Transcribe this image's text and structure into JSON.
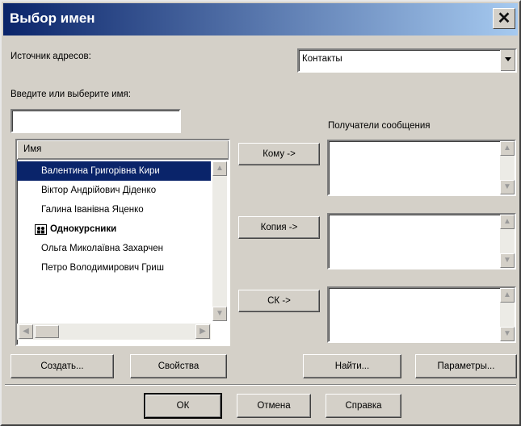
{
  "window": {
    "title": "Выбор имен"
  },
  "address_source": {
    "label": "Источник адресов:",
    "value": "Контакты"
  },
  "name_input": {
    "label": "Введите или выберите имя:",
    "value": ""
  },
  "names_list": {
    "header": "Имя",
    "items": [
      {
        "label": "Валентина Григорівна Кири",
        "selected": true,
        "group": false
      },
      {
        "label": "Віктор Андрійович Діденко",
        "selected": false,
        "group": false
      },
      {
        "label": "Галина Іванівна Яценко",
        "selected": false,
        "group": false
      },
      {
        "label": "Однокурсники",
        "selected": false,
        "group": true
      },
      {
        "label": "Ольга Миколаївна Захарчен",
        "selected": false,
        "group": false
      },
      {
        "label": "Петро Володимирович Гриш",
        "selected": false,
        "group": false
      }
    ]
  },
  "recipients": {
    "label": "Получатели сообщения",
    "to_button": "Кому ->",
    "cc_button": "Копия ->",
    "bcc_button": "СК ->"
  },
  "buttons": {
    "create": "Создать...",
    "properties": "Свойства",
    "find": "Найти...",
    "options": "Параметры...",
    "ok": "ОК",
    "cancel": "Отмена",
    "help": "Справка"
  },
  "colors": {
    "title_start": "#0a246a",
    "title_end": "#a6caf0",
    "selection": "#0a246a",
    "face": "#d4d0c8"
  }
}
